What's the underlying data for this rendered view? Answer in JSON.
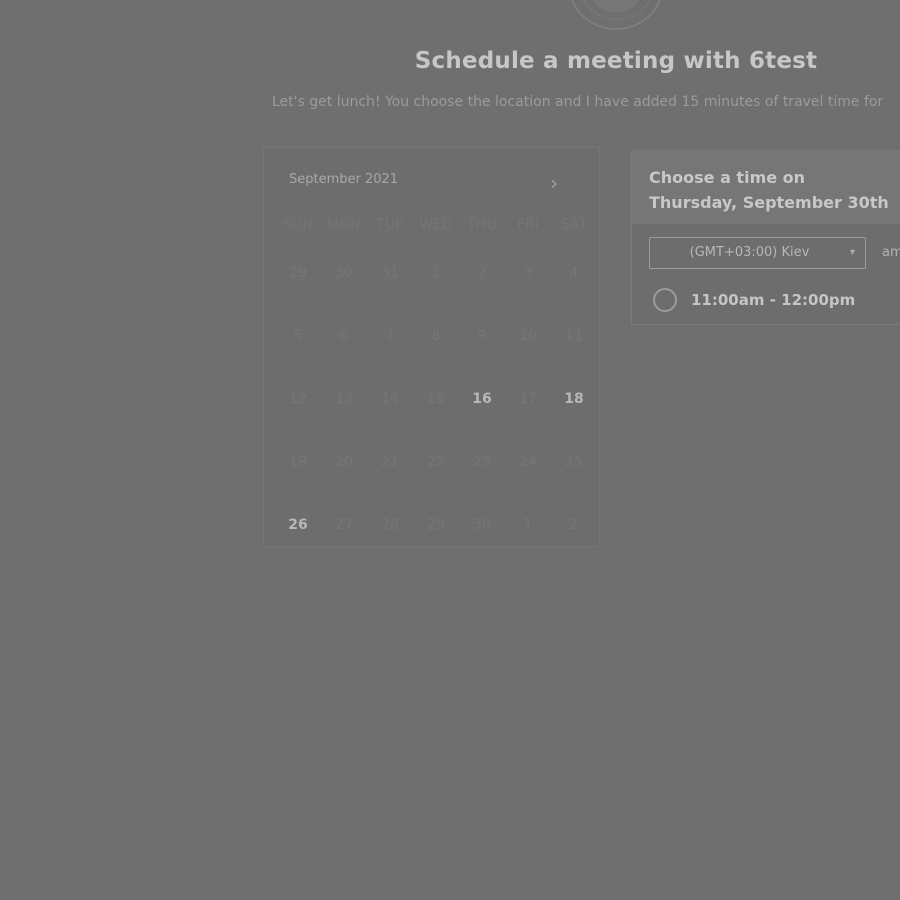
{
  "header": {
    "title": "Schedule a meeting with 6test",
    "subtitle": "Let's get lunch! You choose the location and I have added 15 minutes of travel time for"
  },
  "calendar": {
    "month_label": "September 2021",
    "prev_icon": "chevron-left-icon",
    "next_icon": "chevron-right-icon",
    "weekdays": [
      "SUN",
      "MON",
      "TUE",
      "WED",
      "THU",
      "FRI",
      "SAT"
    ],
    "weeks": [
      [
        "29",
        "30",
        "31",
        "1",
        "2",
        "3",
        "4"
      ],
      [
        "5",
        "6",
        "7",
        "8",
        "9",
        "10",
        "11"
      ],
      [
        "12",
        "13",
        "14",
        "15",
        "16",
        "17",
        "18"
      ],
      [
        "19",
        "20",
        "21",
        "22",
        "23",
        "24",
        "25"
      ],
      [
        "26",
        "27",
        "28",
        "29",
        "30",
        "1",
        "2"
      ]
    ]
  },
  "time_panel": {
    "title": "Choose a time on Thursday, September 30th",
    "timezone": "(GMT+03:00) Kiev",
    "timezone_arrow_icon": "caret-down-icon",
    "ampm_label": "am/pm",
    "slot": "11:00am - 12:00pm"
  }
}
